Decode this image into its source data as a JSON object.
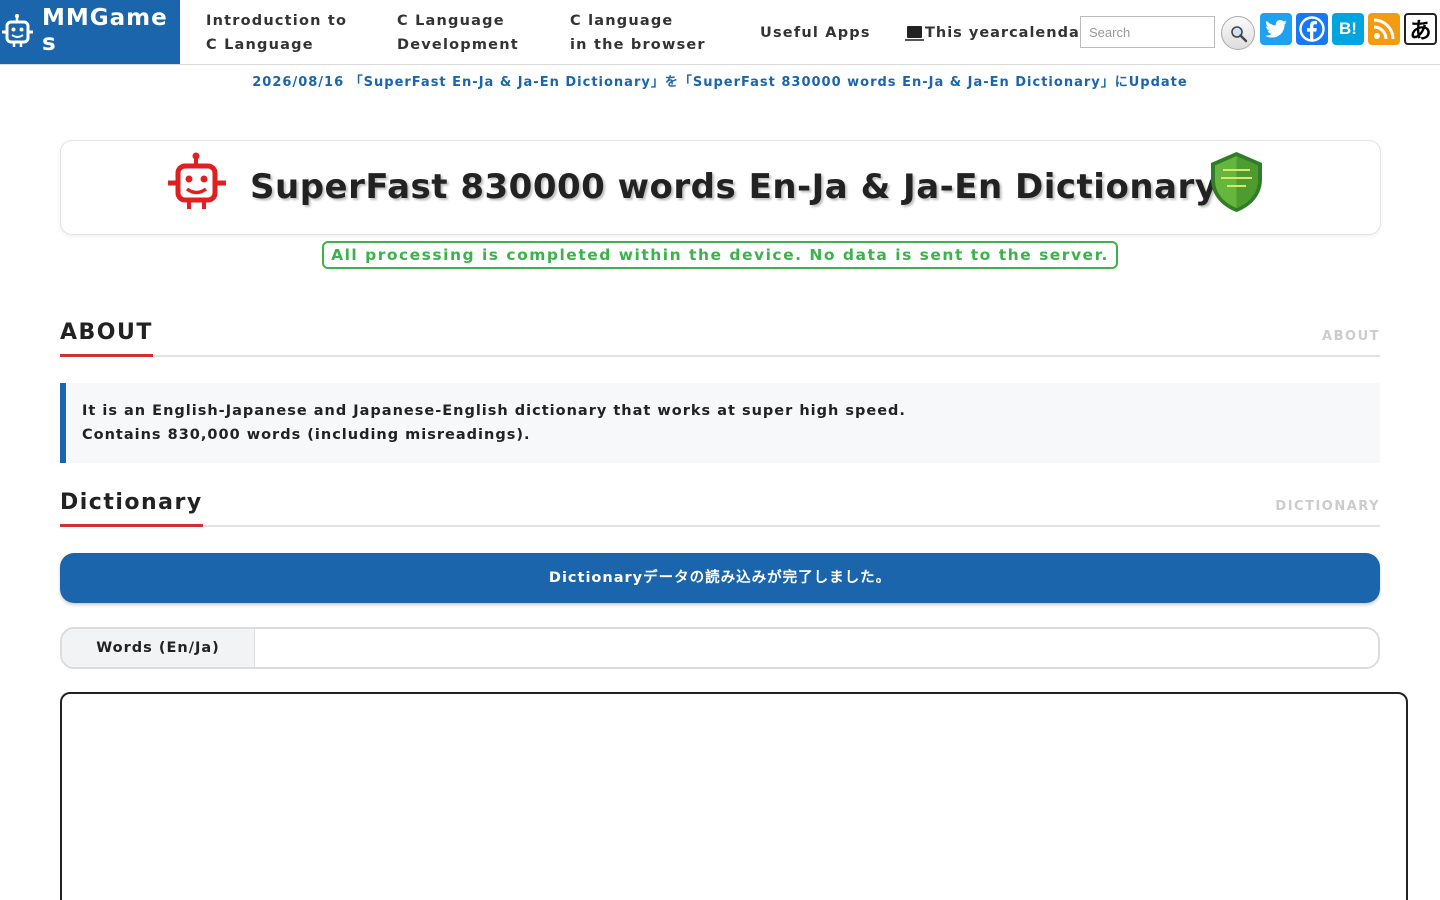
{
  "header": {
    "logo_line1": "MMGame",
    "logo_line2": "s",
    "nav": [
      {
        "line1": "Introduction to",
        "line2": "C Language"
      },
      {
        "line1": "C Language",
        "line2": "Development"
      },
      {
        "line1": "C language",
        "line2": "in the browser"
      },
      {
        "line1": "Useful Apps"
      }
    ],
    "calendar_label": "This yearcalendar",
    "search_placeholder": "Search",
    "social": {
      "twitter_icon": "twitter-icon",
      "facebook_icon": "facebook-icon",
      "hatena_label": "B!",
      "rss_icon": "rss-icon",
      "japanese_label": "あ"
    }
  },
  "notice": "2026/08/16 「SuperFast En-Ja & Ja-En Dictionary」を「SuperFast 830000 words En-Ja & Ja-En Dictionary」にUpdate",
  "page_title": "SuperFast 830000 words En-Ja & Ja-En Dictionary",
  "privacy_note": "All processing is completed within the device. No data is sent to the server.",
  "about": {
    "title": "ABOUT",
    "subtitle": "ABOUT",
    "lines": [
      "It is an English-Japanese and Japanese-English dictionary that works at super high speed.",
      "Contains 830,000 words (including misreadings)."
    ]
  },
  "dictionary": {
    "title": "Dictionary",
    "subtitle": "DICTIONARY",
    "status": "Dictionaryデータの読み込みが完了しました。",
    "words_label": "Words (En/Ja)",
    "words_value": "",
    "result_text": ""
  },
  "colors": {
    "brand_blue": "#1b65ad",
    "accent_red": "#d0312d",
    "privacy_green": "#3cb34a",
    "robot_red": "#e02020",
    "shield_green": "#5aa832"
  }
}
